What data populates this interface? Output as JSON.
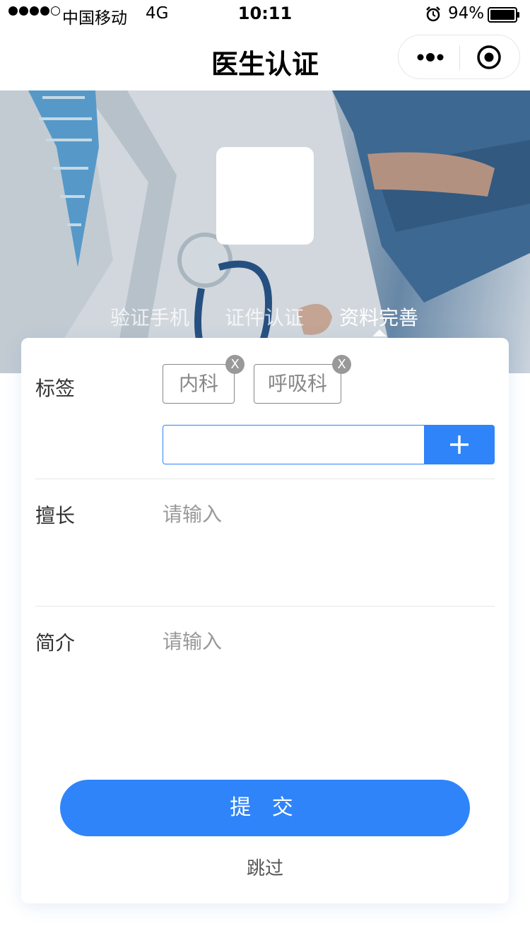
{
  "status_bar": {
    "carrier": "中国移动",
    "network": "4G",
    "time": "10:11",
    "battery": "94%",
    "icons": [
      "signal-icon",
      "alarm-icon",
      "battery-icon"
    ]
  },
  "nav": {
    "title": "医生认证",
    "icons": [
      "more-icon",
      "target-icon"
    ]
  },
  "steps": {
    "items": [
      {
        "label": "验证手机"
      },
      {
        "label": "证件认证"
      },
      {
        "label": "资料完善"
      }
    ],
    "active_index": 2
  },
  "form": {
    "tags": {
      "label": "标签",
      "items": [
        {
          "text": "内科",
          "remove": "X"
        },
        {
          "text": "呼吸科",
          "remove": "X"
        }
      ],
      "input_value": "",
      "add_icon": "plus-icon"
    },
    "skill": {
      "label": "擅长",
      "placeholder": "请输入"
    },
    "intro": {
      "label": "简介",
      "placeholder": "请输入"
    },
    "submit_label": "提 交",
    "skip_label": "跳过"
  },
  "colors": {
    "primary": "#2f84f9",
    "text": "#333333",
    "muted": "#999999",
    "border": "#e5e5e5"
  }
}
